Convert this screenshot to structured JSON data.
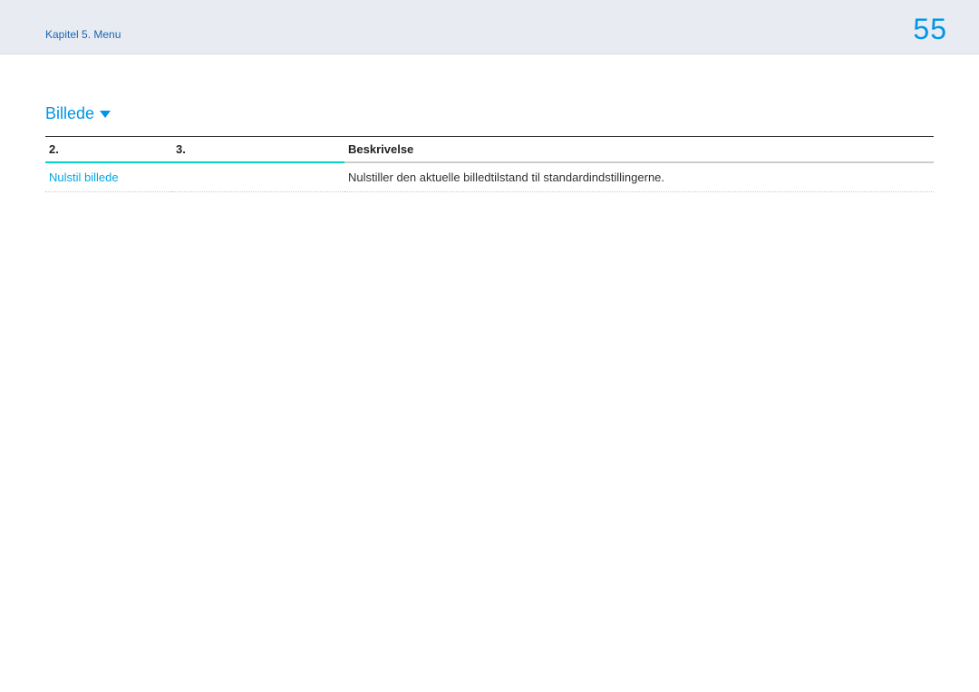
{
  "header": {
    "breadcrumb": "Kapitel 5. Menu",
    "page_number": "55"
  },
  "section": {
    "title": "Billede"
  },
  "table": {
    "headers": {
      "col2": "2.",
      "col3": "3.",
      "col_desc": "Beskrivelse"
    },
    "rows": [
      {
        "menu_item": "Nulstil billede",
        "col3": "",
        "description": "Nulstiller den aktuelle billedtilstand til standardindstillingerne."
      }
    ]
  }
}
